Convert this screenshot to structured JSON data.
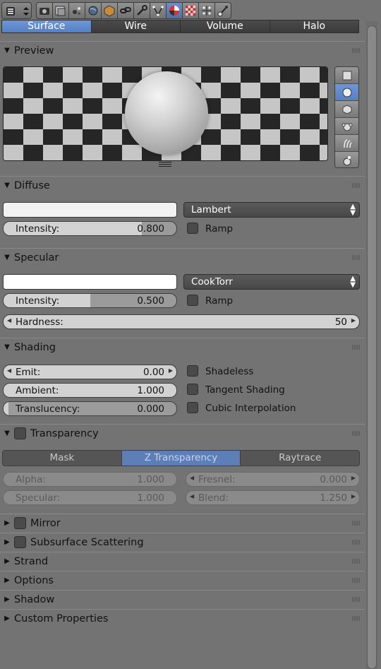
{
  "header": {
    "editor_icon": "properties-editor-icon",
    "context_icons": [
      "render-icon",
      "render-layers-icon",
      "scene-icon",
      "world-icon",
      "object-icon",
      "constraints-icon",
      "modifiers-icon",
      "data-icon",
      "material-icon",
      "texture-icon",
      "particles-icon",
      "physics-icon"
    ],
    "active_context": "material-icon"
  },
  "tabs": [
    "Surface",
    "Wire",
    "Volume",
    "Halo"
  ],
  "active_tab": "Surface",
  "preview": {
    "title": "Preview",
    "shapes": [
      "flat-icon",
      "sphere-icon",
      "cube-icon",
      "monkey-icon",
      "hair-icon",
      "sphere-with-sky-icon"
    ],
    "active_shape": "sphere-icon"
  },
  "diffuse": {
    "title": "Diffuse",
    "color": "#f2f2f2",
    "shader": "Lambert",
    "intensity_label": "Intensity:",
    "intensity_value": "0.800",
    "ramp_label": "Ramp"
  },
  "specular": {
    "title": "Specular",
    "color": "#ffffff",
    "shader": "CookTorr",
    "intensity_label": "Intensity:",
    "intensity_value": "0.500",
    "ramp_label": "Ramp",
    "hardness_label": "Hardness:",
    "hardness_value": "50"
  },
  "shading": {
    "title": "Shading",
    "emit_label": "Emit:",
    "emit_value": "0.00",
    "ambient_label": "Ambient:",
    "ambient_value": "1.000",
    "translucency_label": "Translucency:",
    "translucency_value": "0.000",
    "shadeless_label": "Shadeless",
    "tangent_label": "Tangent Shading",
    "cubic_label": "Cubic Interpolation"
  },
  "transparency": {
    "title": "Transparency",
    "modes": [
      "Mask",
      "Z Transparency",
      "Raytrace"
    ],
    "active_mode": "Z Transparency",
    "alpha_label": "Alpha:",
    "alpha_value": "1.000",
    "specular_label": "Specular:",
    "specular_value": "1.000",
    "fresnel_label": "Fresnel:",
    "fresnel_value": "0.000",
    "blend_label": "Blend:",
    "blend_value": "1.250"
  },
  "collapsed_panels": {
    "mirror": "Mirror",
    "sss": "Subsurface Scattering",
    "strand": "Strand",
    "options": "Options",
    "shadow": "Shadow",
    "custom": "Custom Properties"
  },
  "colors": {
    "accent": "#5680c4",
    "panel_bg": "#737373"
  }
}
